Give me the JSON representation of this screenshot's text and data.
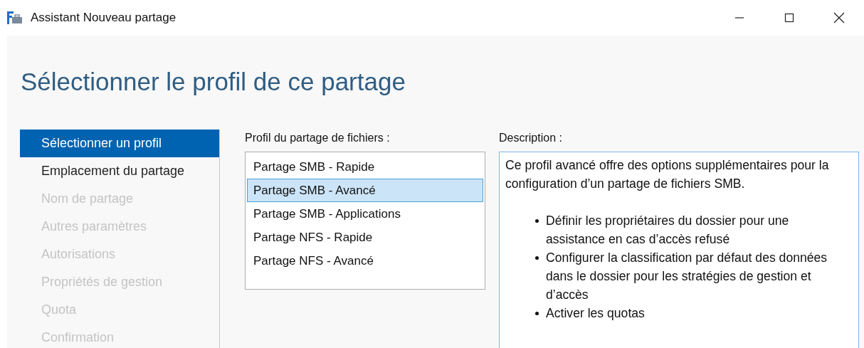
{
  "window": {
    "title": "Assistant Nouveau partage"
  },
  "heading": "Sélectionner le profil de ce partage",
  "steps": [
    {
      "label": "Sélectionner un profil",
      "selected": true,
      "disabled": false
    },
    {
      "label": "Emplacement du partage",
      "selected": false,
      "disabled": false
    },
    {
      "label": "Nom de partage",
      "selected": false,
      "disabled": true
    },
    {
      "label": "Autres paramètres",
      "selected": false,
      "disabled": true
    },
    {
      "label": "Autorisations",
      "selected": false,
      "disabled": true
    },
    {
      "label": "Propriétés de gestion",
      "selected": false,
      "disabled": true
    },
    {
      "label": "Quota",
      "selected": false,
      "disabled": true
    },
    {
      "label": "Confirmation",
      "selected": false,
      "disabled": true
    }
  ],
  "profiles": {
    "label": "Profil du partage de fichiers :",
    "items": [
      {
        "label": "Partage SMB - Rapide",
        "selected": false
      },
      {
        "label": "Partage SMB - Avancé",
        "selected": true
      },
      {
        "label": "Partage SMB - Applications",
        "selected": false
      },
      {
        "label": "Partage NFS - Rapide",
        "selected": false
      },
      {
        "label": "Partage NFS - Avancé",
        "selected": false
      }
    ]
  },
  "description": {
    "label": "Description :",
    "text": "Ce profil avancé offre des options supplémentaires pour la configuration d’un partage de fichiers SMB.",
    "bullets": [
      "Définir les propriétaires du dossier pour une assistance en cas d’accès refusé",
      "Configurer la classification par défaut des données dans le dossier pour les stratégies de gestion et d’accès",
      "Activer les quotas"
    ]
  }
}
